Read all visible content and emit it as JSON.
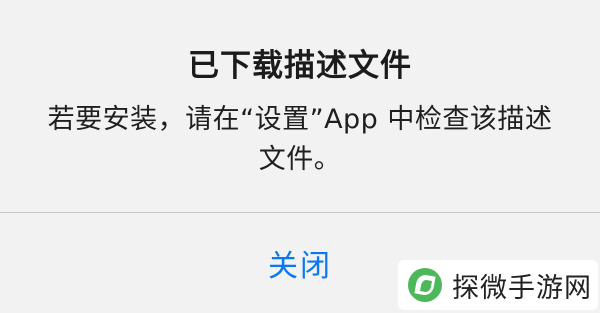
{
  "alert": {
    "title": "已下载描述文件",
    "message": "若要安装，请在“设置”App 中检查该描述文件。",
    "close_label": "关闭"
  },
  "watermark": {
    "text": "探微手游网",
    "logo_icon": "leaf-logo-icon"
  },
  "colors": {
    "accent": "#0a78f5",
    "background": "#f2f2f2",
    "title_text": "#1b1b1b",
    "divider": "#c8c8c8",
    "watermark_logo": "#4cb85a"
  }
}
